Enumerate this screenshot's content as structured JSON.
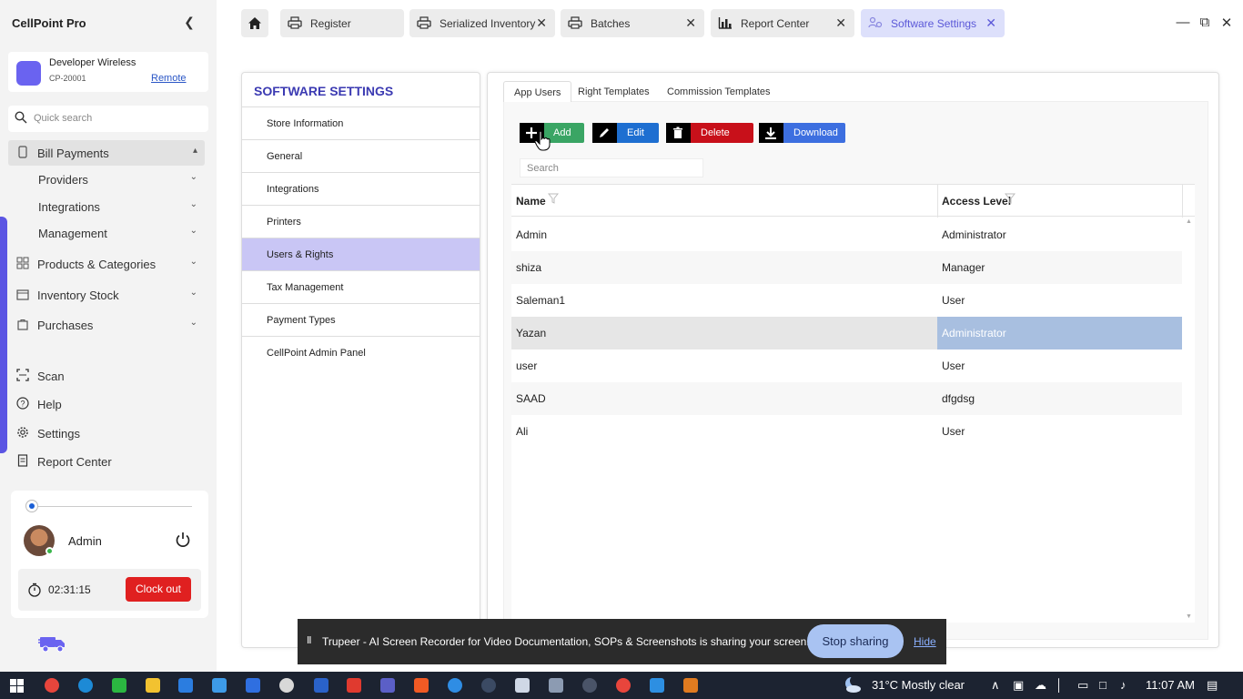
{
  "app": {
    "title": "CellPoint Pro"
  },
  "store": {
    "name": "Developer Wireless",
    "id": "CP-20001",
    "mode_link": "Remote"
  },
  "quick_search": {
    "placeholder": "Quick search"
  },
  "nav": {
    "bill_payments": "Bill Payments",
    "providers": "Providers",
    "integrations": "Integrations",
    "management": "Management",
    "products": "Products & Categories",
    "inventory": "Inventory Stock",
    "purchases": "Purchases",
    "scan": "Scan",
    "help": "Help",
    "settings": "Settings",
    "report_center": "Report Center"
  },
  "user": {
    "name": "Admin",
    "timer": "02:31:15",
    "clock_out": "Clock out"
  },
  "tabs": [
    {
      "label": "Register",
      "icon": "printer-icon"
    },
    {
      "label": "Serialized Inventory",
      "icon": "printer-icon"
    },
    {
      "label": "Batches",
      "icon": "printer-icon"
    },
    {
      "label": "Report Center",
      "icon": "bar-chart-icon"
    },
    {
      "label": "Software Settings",
      "icon": "gear-users-icon",
      "active": true
    }
  ],
  "settings_menu": {
    "title": "SOFTWARE SETTINGS",
    "items": [
      "Store Information",
      "General",
      "Integrations",
      "Printers",
      "Users & Rights",
      "Tax Management",
      "Payment Types",
      "CellPoint Admin Panel"
    ],
    "selected": "Users & Rights"
  },
  "content": {
    "tabs": [
      "App Users",
      "Right Templates",
      "Commission Templates"
    ],
    "active_tab": "App Users",
    "buttons": {
      "add": "Add",
      "edit": "Edit",
      "delete": "Delete",
      "download": "Download"
    },
    "search_placeholder": "Search",
    "columns": [
      "Name",
      "Access Level"
    ],
    "rows": [
      {
        "name": "Admin",
        "access": "Administrator"
      },
      {
        "name": "shiza",
        "access": "Manager"
      },
      {
        "name": "Saleman1",
        "access": "User"
      },
      {
        "name": "Yazan",
        "access": "Administrator"
      },
      {
        "name": "user",
        "access": "User"
      },
      {
        "name": "SAAD",
        "access": "dfgdsg"
      },
      {
        "name": "Ali",
        "access": "User"
      }
    ],
    "selected_row": "Yazan"
  },
  "share_banner": {
    "text": "Trupeer - AI Screen Recorder for Video Documentation, SOPs & Screenshots is sharing your screen.",
    "stop": "Stop sharing",
    "hide": "Hide"
  },
  "taskbar": {
    "weather": "31°C  Mostly clear",
    "time": "11:07 AM"
  },
  "colors": {
    "accent": "#5b55e3",
    "selected_menu": "#c9c6f5",
    "add": "#3aa564",
    "edit": "#1e6fd1",
    "delete": "#c8101a",
    "download": "#3d6fe0",
    "clock_out": "#e02020",
    "selected_cell": "#a8bfe0"
  }
}
